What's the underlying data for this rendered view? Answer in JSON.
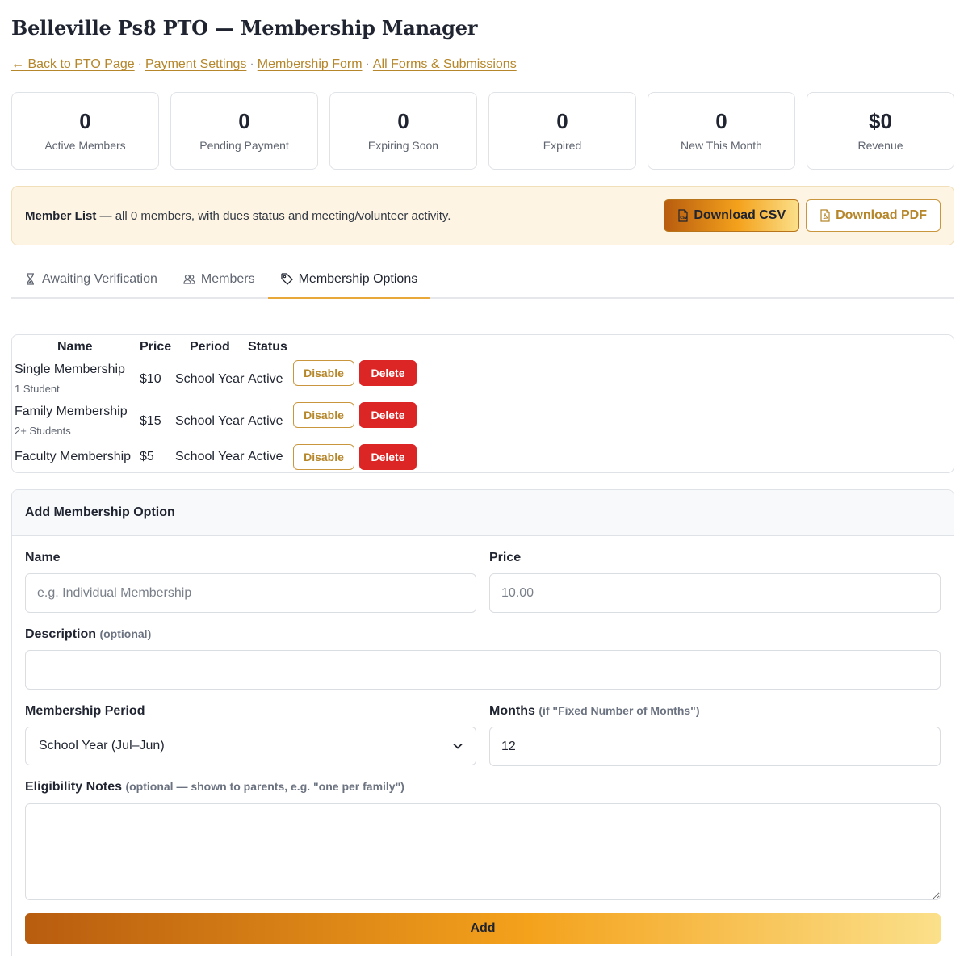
{
  "title": "Belleville Ps8 PTO — Membership Manager",
  "breadcrumb": {
    "links": [
      "← Back to PTO Page",
      "Payment Settings",
      "Membership Form",
      "All Forms & Submissions"
    ],
    "separator": "·"
  },
  "stats": [
    {
      "value": "0",
      "label": "Active Members"
    },
    {
      "value": "0",
      "label": "Pending Payment"
    },
    {
      "value": "0",
      "label": "Expiring Soon"
    },
    {
      "value": "0",
      "label": "Expired"
    },
    {
      "value": "0",
      "label": "New This Month"
    },
    {
      "value": "$0",
      "label": "Revenue"
    }
  ],
  "banner": {
    "title": "Member List",
    "text": " — all 0 members, with dues status and meeting/volunteer activity.",
    "download_csv": "Download CSV",
    "download_pdf": "Download PDF"
  },
  "tabs": [
    {
      "label": "Awaiting Verification",
      "icon": "hourglass-icon",
      "active": false
    },
    {
      "label": "Members",
      "icon": "users-icon",
      "active": false
    },
    {
      "label": "Membership Options",
      "icon": "tag-icon",
      "active": true
    }
  ],
  "options_table": {
    "headers": {
      "name": "Name",
      "price": "Price",
      "period": "Period",
      "status": "Status"
    },
    "disable_label": "Disable",
    "delete_label": "Delete",
    "rows": [
      {
        "name": "Single Membership",
        "sub": "1 Student",
        "price": "$10",
        "period": "School Year",
        "status": "Active"
      },
      {
        "name": "Family Membership",
        "sub": "2+ Students",
        "price": "$15",
        "period": "School Year",
        "status": "Active"
      },
      {
        "name": "Faculty Membership",
        "sub": "",
        "price": "$5",
        "period": "School Year",
        "status": "Active"
      }
    ]
  },
  "form": {
    "heading": "Add Membership Option",
    "name_label": "Name",
    "name_placeholder": "e.g. Individual Membership",
    "price_label": "Price",
    "price_placeholder": "10.00",
    "description_label": "Description",
    "description_hint": "(optional)",
    "period_label": "Membership Period",
    "period_value": "School Year (Jul–Jun)",
    "months_label": "Months",
    "months_hint": "(if \"Fixed Number of Months\")",
    "months_value": "12",
    "eligibility_label": "Eligibility Notes",
    "eligibility_hint": "(optional — shown to parents, e.g. \"one per family\")",
    "add_label": "Add"
  },
  "colors": {
    "accent": "#b5862a",
    "danger": "#dc2626",
    "banner_bg": "#fdf4e3",
    "gradient_start": "#b85c0f",
    "gradient_mid": "#f4a21c",
    "gradient_end": "#fbe08a"
  }
}
